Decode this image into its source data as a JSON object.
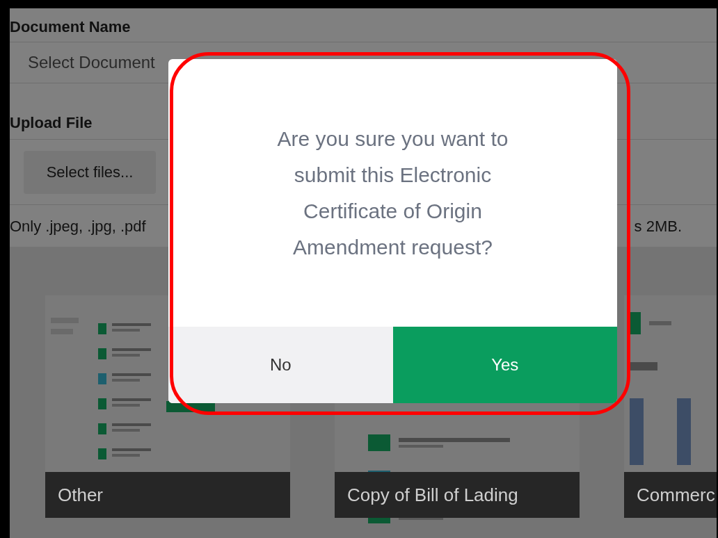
{
  "form": {
    "document_name": {
      "label": "Document Name",
      "placeholder": "Select Document"
    },
    "upload": {
      "label": "Upload File",
      "button": "Select files...",
      "hint_left": "Only .jpeg, .jpg, .pdf",
      "hint_right": "s 2MB."
    }
  },
  "previews": [
    {
      "caption": "Other",
      "kind": "list-detail"
    },
    {
      "caption": "Copy of Bill of Lading",
      "kind": "activity-list"
    },
    {
      "caption": "Commerc",
      "kind": "dashboard"
    }
  ],
  "dialog": {
    "message": "Are you sure you want to submit this Electronic Certificate of Origin Amendment request?",
    "buttons": [
      {
        "label": "No",
        "kind": "secondary"
      },
      {
        "label": "Yes",
        "kind": "primary"
      }
    ]
  }
}
